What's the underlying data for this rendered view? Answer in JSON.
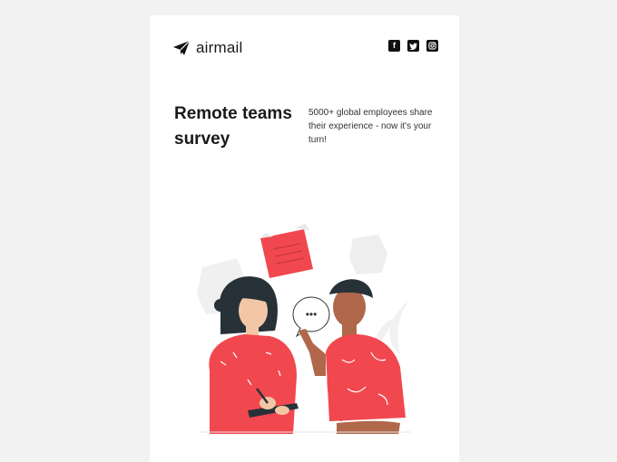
{
  "brand": {
    "name": "airmail",
    "logo_icon": "paper-plane-icon"
  },
  "social": [
    {
      "icon": "facebook-icon",
      "glyph": "f"
    },
    {
      "icon": "twitter-icon",
      "glyph": "t"
    },
    {
      "icon": "instagram-icon",
      "glyph": "o"
    }
  ],
  "hero": {
    "title": "Remote teams survey",
    "description": "5000+ global employees share their experience - now it's your turn!"
  },
  "illustration": {
    "speech_bubble": "•••"
  },
  "colors": {
    "accent": "#f1474f",
    "page_bg": "#f2f2f2",
    "card_bg": "#ffffff",
    "text": "#1a1a1a"
  }
}
